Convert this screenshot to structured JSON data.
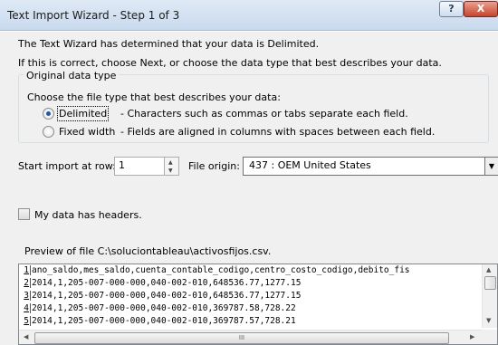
{
  "window": {
    "title": "Text Import Wizard - Step 1 of 3",
    "help_label": "?",
    "close_label": "X"
  },
  "intro": {
    "line1": "The Text Wizard has determined that your data is Delimited.",
    "line2": "If this is correct, choose Next, or choose the data type that best describes your data."
  },
  "original_data_type": {
    "group_label": "Original data type",
    "prompt": "Choose the file type that best describes your data:",
    "options": [
      {
        "label": "Delimited",
        "description": "- Characters such as commas or tabs separate each field.",
        "selected": true
      },
      {
        "label": "Fixed width",
        "description": "- Fields are aligned in columns with spaces between each field.",
        "selected": false
      }
    ]
  },
  "import_settings": {
    "start_row_label": "Start import at row:",
    "start_row_value": "1",
    "file_origin_label": "File origin:",
    "file_origin_value": "437 : OEM United States"
  },
  "headers": {
    "label": "My data has headers.",
    "checked": false
  },
  "preview": {
    "label": "Preview of file C:\\soluciontableau\\activosfijos.csv.",
    "rows": [
      {
        "num": "1",
        "text": "ano_saldo,mes_saldo,cuenta_contable_codigo,centro_costo_codigo,debito_fis"
      },
      {
        "num": "2",
        "text": "2014,1,205-007-000-000,040-002-010,648536.77,1277.15"
      },
      {
        "num": "3",
        "text": "2014,1,205-007-000-000,040-002-010,648536.77,1277.15"
      },
      {
        "num": "4",
        "text": "2014,1,205-007-000-000,040-002-010,369787.58,728.22"
      },
      {
        "num": "5",
        "text": "2014,1,205-007-000-000,040-002-010,369787.57,728.21"
      }
    ],
    "hscroll_grip": "III"
  }
}
